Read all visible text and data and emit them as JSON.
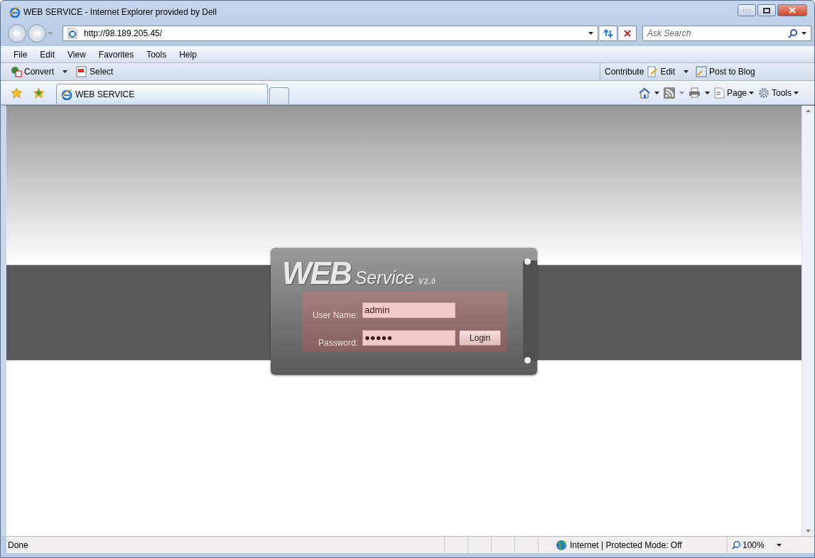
{
  "window": {
    "title": "WEB SERVICE - Internet Explorer provided by Dell"
  },
  "address_bar": {
    "url": "http://98.189.205.45/"
  },
  "search": {
    "placeholder": "Ask Search"
  },
  "menu": [
    "File",
    "Edit",
    "View",
    "Favorites",
    "Tools",
    "Help"
  ],
  "toolbar_left": [
    "Convert",
    "Select"
  ],
  "toolbar_right": [
    "Contribute",
    "Edit",
    "Post to Blog"
  ],
  "tabs": [
    {
      "label": "WEB SERVICE",
      "selected": true
    }
  ],
  "command_bar": [
    "Page",
    "Tools"
  ],
  "login": {
    "logo_main": "WEB",
    "logo_sub": "Service",
    "version": "V2.0",
    "fields": [
      {
        "label": "User Name:",
        "value": "admin"
      },
      {
        "label": "Password:",
        "value": "●●●●●"
      }
    ],
    "button": "Login"
  },
  "status_bar": {
    "text": "Done",
    "zone": "Internet | Protected Mode: Off",
    "zoom": "100%"
  }
}
